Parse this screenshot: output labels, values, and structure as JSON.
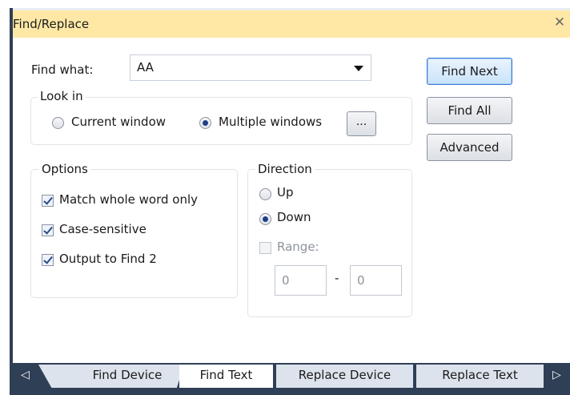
{
  "window": {
    "title": "Find/Replace",
    "close_glyph": "✕"
  },
  "find": {
    "label": "Find what:",
    "value": "AA"
  },
  "look_in": {
    "title": "Look in",
    "options": [
      {
        "label": "Current window",
        "selected": false
      },
      {
        "label": "Multiple windows",
        "selected": true
      }
    ],
    "browse_label": "..."
  },
  "options": {
    "title": "Options",
    "items": [
      {
        "label": "Match whole word only",
        "checked": true
      },
      {
        "label": "Case-sensitive",
        "checked": true
      },
      {
        "label": "Output to Find 2",
        "checked": true
      }
    ]
  },
  "direction": {
    "title": "Direction",
    "options": [
      {
        "label": "Up",
        "selected": false
      },
      {
        "label": "Down",
        "selected": true
      }
    ],
    "range": {
      "label": "Range:",
      "checked": false,
      "from": "0",
      "separator": "-",
      "to": "0"
    }
  },
  "buttons": {
    "find_next": "Find Next",
    "find_all": "Find All",
    "advanced": "Advanced"
  },
  "tabs": {
    "left_arrow": "◁",
    "right_arrow": "▷",
    "items": [
      "Find Device",
      "Find Text",
      "Replace Device",
      "Replace Text"
    ],
    "active": "Find Text"
  },
  "colors": {
    "titlebar": "#ffe8a6",
    "frame": "#2f3f56",
    "default_button": "#c9e3fa"
  },
  "icons": {
    "close": "close-icon",
    "dropdown": "chevron-down-icon",
    "tab_left": "scroll-left-icon",
    "tab_right": "scroll-right-icon"
  }
}
